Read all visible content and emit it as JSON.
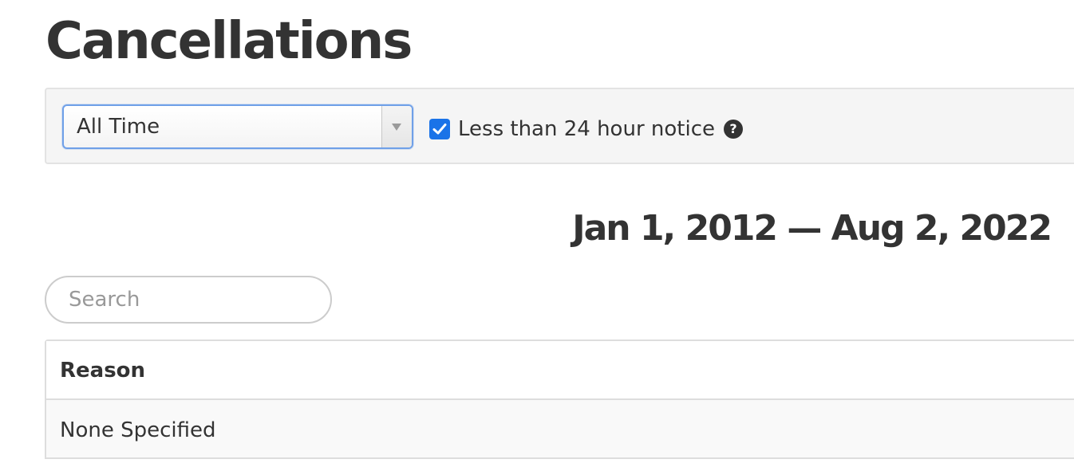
{
  "page": {
    "title": "Cancellations"
  },
  "filters": {
    "range_select": {
      "selected": "All Time"
    },
    "notice_checkbox": {
      "checked": true,
      "label": "Less than 24 hour notice",
      "help_icon": "question-circle-icon"
    }
  },
  "report": {
    "date_range": "Jan 1, 2012 — Aug 2, 2022"
  },
  "search": {
    "placeholder": "Search",
    "value": ""
  },
  "table": {
    "columns": [
      "Reason"
    ],
    "rows": [
      [
        "None Specified"
      ]
    ]
  },
  "colors": {
    "accent": "#1a73e8",
    "select_focus_border": "#6fa0e8",
    "text": "#333333",
    "panel_background": "#f5f5f5"
  }
}
